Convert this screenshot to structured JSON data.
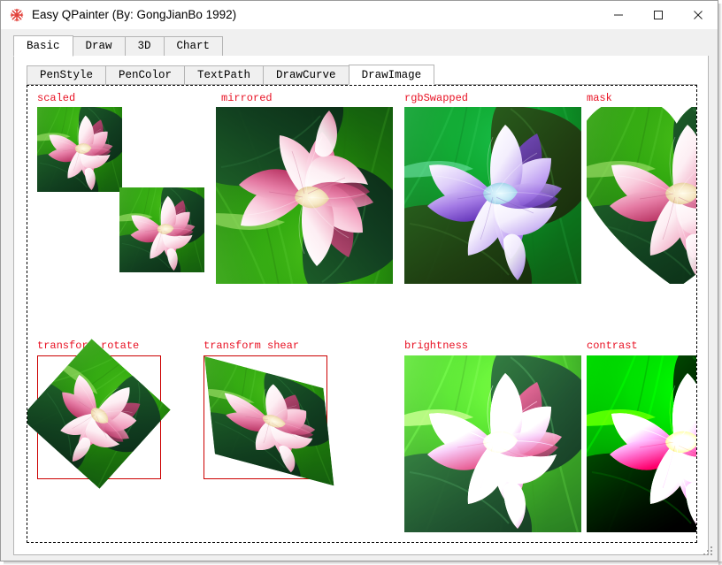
{
  "window": {
    "title": "Easy QPainter (By: GongJianBo 1992)",
    "icon": "snowflake-icon",
    "controls": {
      "minimize": "—",
      "maximize": "□",
      "close": "✕"
    }
  },
  "main_tabs": [
    {
      "label": "Basic",
      "selected": true
    },
    {
      "label": "Draw",
      "selected": false
    },
    {
      "label": "3D",
      "selected": false
    },
    {
      "label": "Chart",
      "selected": false
    }
  ],
  "sub_tabs": [
    {
      "label": "PenStyle",
      "selected": false
    },
    {
      "label": "PenColor",
      "selected": false
    },
    {
      "label": "TextPath",
      "selected": false
    },
    {
      "label": "DrawCurve",
      "selected": false
    },
    {
      "label": "DrawImage",
      "selected": true
    }
  ],
  "canvas": {
    "border_style": "dashed",
    "label_color": "#e81123",
    "guide_rect_color": "#cc0000",
    "demos": [
      {
        "label": "scaled"
      },
      {
        "label": "mirrored"
      },
      {
        "label": "rgbSwapped"
      },
      {
        "label": "mask"
      },
      {
        "label": "transform rotate"
      },
      {
        "label": "transform shear"
      },
      {
        "label": "brightness"
      },
      {
        "label": "contrast"
      }
    ]
  }
}
